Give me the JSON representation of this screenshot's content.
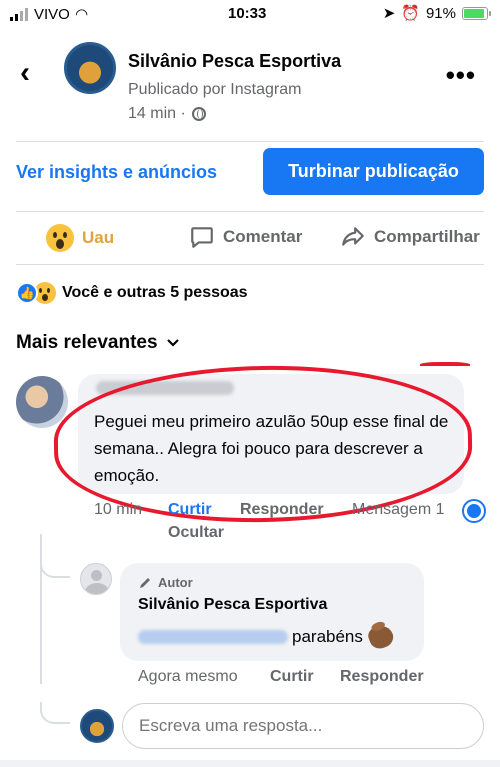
{
  "status_bar": {
    "carrier": "VIVO",
    "time": "10:33",
    "battery": "91%"
  },
  "post_header": {
    "page_name": "Silvânio Pesca Esportiva",
    "published_via": "Publicado por Instagram",
    "time_ago": "14 min ·"
  },
  "promo": {
    "insights_label": "Ver insights e anúncios",
    "boost_label": "Turbinar publicação"
  },
  "actions": {
    "react_label": "Uau",
    "comment_label": "Comentar",
    "share_label": "Compartilhar"
  },
  "reactions": {
    "summary": "Você e outras 5 pessoas"
  },
  "sort": {
    "label": "Mais relevantes"
  },
  "comment": {
    "text": "Peguei meu primeiro azulão 50up esse final de semana.. Alegra foi pouco para descrever a emoção.",
    "time": "10 min",
    "like_label": "Curtir",
    "reply_label": "Responder",
    "message_label": "Mensagem 1",
    "hide_label": "Ocultar"
  },
  "reply": {
    "author_tag": "Autor",
    "author_name": "Silvânio Pesca Esportiva",
    "text": "parabéns",
    "time": "Agora mesmo",
    "like_label": "Curtir",
    "reply_label": "Responder"
  },
  "reply_input": {
    "placeholder": "Escreva uma resposta..."
  },
  "colors": {
    "accent": "#1877f2",
    "wow": "#e0a33a",
    "highlight": "#e8182e"
  }
}
